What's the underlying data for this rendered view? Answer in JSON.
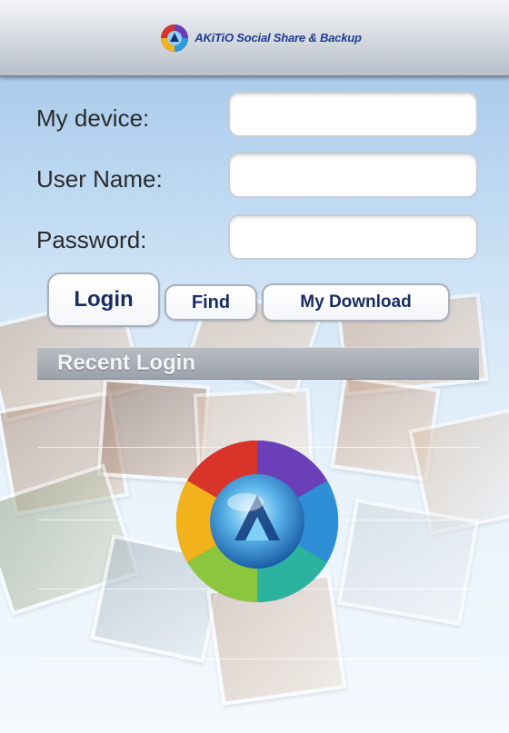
{
  "header": {
    "title": "AKiTiO Social Share & Backup",
    "logo_icon": "akitio-logo-icon"
  },
  "form": {
    "device_label": "My device:",
    "device_value": "",
    "username_label": "User Name:",
    "username_value": "",
    "password_label": "Password:",
    "password_value": ""
  },
  "actions": {
    "login_label": "Login",
    "find_label": "Find",
    "download_label": "My Download"
  },
  "recent": {
    "title": "Recent Login"
  },
  "colors": {
    "brand_blue": "#1f3c91",
    "button_text": "#1a2d63"
  }
}
